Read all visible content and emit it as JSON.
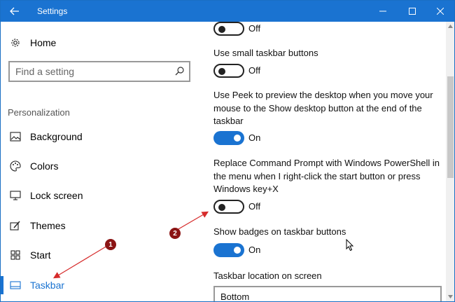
{
  "window": {
    "title": "Settings"
  },
  "sidebar": {
    "home_label": "Home",
    "search_placeholder": "Find a setting",
    "section_label": "Personalization",
    "items": [
      {
        "label": "Background",
        "icon": "picture-icon"
      },
      {
        "label": "Colors",
        "icon": "palette-icon"
      },
      {
        "label": "Lock screen",
        "icon": "monitor-icon"
      },
      {
        "label": "Themes",
        "icon": "brush-icon"
      },
      {
        "label": "Start",
        "icon": "start-tiles-icon"
      },
      {
        "label": "Taskbar",
        "icon": "taskbar-icon",
        "active": true
      }
    ]
  },
  "content": {
    "settings": [
      {
        "label": "",
        "state": "Off",
        "on": false
      },
      {
        "label": "Use small taskbar buttons",
        "state": "Off",
        "on": false
      },
      {
        "label": "Use Peek to preview the desktop when you move your mouse to the Show desktop button at the end of the taskbar",
        "state": "On",
        "on": true
      },
      {
        "label": "Replace Command Prompt with Windows PowerShell in the menu when I right-click the start button or press Windows key+X",
        "state": "Off",
        "on": false
      },
      {
        "label": "Show badges on taskbar buttons",
        "state": "On",
        "on": true
      }
    ],
    "location_label": "Taskbar location on screen",
    "location_value": "Bottom"
  },
  "annotations": {
    "callout_1": "1",
    "callout_2": "2"
  },
  "colors": {
    "accent": "#1a73d1",
    "callout": "#8b1414",
    "arrow": "#d62b2b"
  }
}
